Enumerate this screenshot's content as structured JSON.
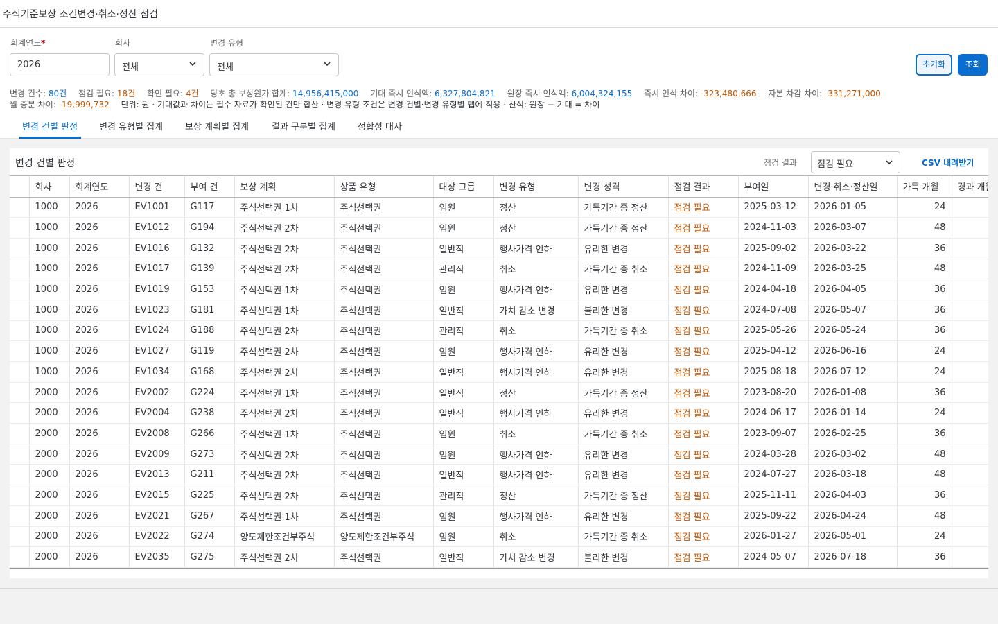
{
  "page": {
    "title": "주식기준보상 조건변경·취소·정산 점검"
  },
  "filters": {
    "fiscal_year": {
      "label": "회계연도",
      "required_mark": "*",
      "value": "2026"
    },
    "company": {
      "label": "회사",
      "value": "전체"
    },
    "change_type": {
      "label": "변경 유형",
      "value": "전체"
    },
    "reset_label": "초기화",
    "search_label": "조회"
  },
  "summary": {
    "items": [
      {
        "label": "변경 건수: ",
        "value": "80건",
        "tone": "v"
      },
      {
        "label": "점검 필요: ",
        "value": "18건",
        "tone": "w"
      },
      {
        "label": "확인 필요: ",
        "value": "4건",
        "tone": "w"
      },
      {
        "label": "당초 총 보상원가 합계: ",
        "value": "14,956,415,000",
        "tone": "v"
      },
      {
        "label": "기대 즉시 인식액: ",
        "value": "6,327,804,821",
        "tone": "v"
      },
      {
        "label": "원장 즉시 인식액: ",
        "value": "6,004,324,155",
        "tone": "v"
      },
      {
        "label": "즉시 인식 차이: ",
        "value": "-323,480,666",
        "tone": "neg"
      },
      {
        "label": "자본 차감 차이: ",
        "value": "-331,271,000",
        "tone": "neg"
      },
      {
        "label": "월 증분 차이: ",
        "value": "-19,999,732",
        "tone": "neg"
      }
    ],
    "note": "단위: 원 · 기대값과 차이는 필수 자료가 확인된 건만 합산 · 변경 유형 조건은 변경 건별·변경 유형별 탭에 적용 · 산식: 원장 − 기대 = 차이"
  },
  "tabs": [
    {
      "label": "변경 건별 판정",
      "active": true
    },
    {
      "label": "변경 유형별 집계",
      "active": false
    },
    {
      "label": "보상 계획별 집계",
      "active": false
    },
    {
      "label": "결과 구분별 집계",
      "active": false
    },
    {
      "label": "정합성 대사",
      "active": false
    }
  ],
  "panel": {
    "title": "변경 건별 판정",
    "result_filter_label": "점검 결과",
    "result_filter_value": "점검 필요",
    "csv_label": "CSV 내려받기"
  },
  "table": {
    "columns": [
      "",
      "회사",
      "회계연도",
      "변경 건",
      "부여 건",
      "보상 계획",
      "상품 유형",
      "대상 그룹",
      "변경 유형",
      "변경 성격",
      "점검 결과",
      "부여일",
      "변경·취소·정산일",
      "가득 개월",
      "경과 개월"
    ],
    "rows": [
      [
        "",
        "1000",
        "2026",
        "EV1001",
        "G117",
        "주식선택권 1차",
        "주식선택권",
        "임원",
        "정산",
        "가득기간 중 정산",
        "점검 필요",
        "2025-03-12",
        "2026-01-05",
        "24",
        ""
      ],
      [
        "",
        "1000",
        "2026",
        "EV1012",
        "G194",
        "주식선택권 2차",
        "주식선택권",
        "임원",
        "정산",
        "가득기간 중 정산",
        "점검 필요",
        "2024-11-03",
        "2026-03-07",
        "48",
        ""
      ],
      [
        "",
        "1000",
        "2026",
        "EV1016",
        "G132",
        "주식선택권 2차",
        "주식선택권",
        "일반직",
        "행사가격 인하",
        "유리한 변경",
        "점검 필요",
        "2025-09-02",
        "2026-03-22",
        "36",
        ""
      ],
      [
        "",
        "1000",
        "2026",
        "EV1017",
        "G139",
        "주식선택권 2차",
        "주식선택권",
        "관리직",
        "취소",
        "가득기간 중 취소",
        "점검 필요",
        "2024-11-09",
        "2026-03-25",
        "48",
        ""
      ],
      [
        "",
        "1000",
        "2026",
        "EV1019",
        "G153",
        "주식선택권 1차",
        "주식선택권",
        "임원",
        "행사가격 인하",
        "유리한 변경",
        "점검 필요",
        "2024-04-18",
        "2026-04-05",
        "36",
        ""
      ],
      [
        "",
        "1000",
        "2026",
        "EV1023",
        "G181",
        "주식선택권 1차",
        "주식선택권",
        "일반직",
        "가치 감소 변경",
        "불리한 변경",
        "점검 필요",
        "2024-07-08",
        "2026-05-07",
        "36",
        ""
      ],
      [
        "",
        "1000",
        "2026",
        "EV1024",
        "G188",
        "주식선택권 2차",
        "주식선택권",
        "관리직",
        "취소",
        "가득기간 중 취소",
        "점검 필요",
        "2025-05-26",
        "2026-05-24",
        "36",
        ""
      ],
      [
        "",
        "1000",
        "2026",
        "EV1027",
        "G119",
        "주식선택권 2차",
        "주식선택권",
        "임원",
        "행사가격 인하",
        "유리한 변경",
        "점검 필요",
        "2025-04-12",
        "2026-06-16",
        "24",
        ""
      ],
      [
        "",
        "1000",
        "2026",
        "EV1034",
        "G168",
        "주식선택권 2차",
        "주식선택권",
        "일반직",
        "행사가격 인하",
        "유리한 변경",
        "점검 필요",
        "2025-08-18",
        "2026-07-12",
        "24",
        ""
      ],
      [
        "",
        "2000",
        "2026",
        "EV2002",
        "G224",
        "주식선택권 1차",
        "주식선택권",
        "일반직",
        "정산",
        "가득기간 중 정산",
        "점검 필요",
        "2023-08-20",
        "2026-01-08",
        "36",
        ""
      ],
      [
        "",
        "2000",
        "2026",
        "EV2004",
        "G238",
        "주식선택권 2차",
        "주식선택권",
        "일반직",
        "행사가격 인하",
        "유리한 변경",
        "점검 필요",
        "2024-06-17",
        "2026-01-14",
        "24",
        ""
      ],
      [
        "",
        "2000",
        "2026",
        "EV2008",
        "G266",
        "주식선택권 1차",
        "주식선택권",
        "임원",
        "취소",
        "가득기간 중 취소",
        "점검 필요",
        "2023-09-07",
        "2026-02-25",
        "36",
        ""
      ],
      [
        "",
        "2000",
        "2026",
        "EV2009",
        "G273",
        "주식선택권 2차",
        "주식선택권",
        "임원",
        "행사가격 인하",
        "유리한 변경",
        "점검 필요",
        "2024-03-28",
        "2026-03-02",
        "48",
        ""
      ],
      [
        "",
        "2000",
        "2026",
        "EV2013",
        "G211",
        "주식선택권 2차",
        "주식선택권",
        "일반직",
        "행사가격 인하",
        "유리한 변경",
        "점검 필요",
        "2024-07-27",
        "2026-03-18",
        "48",
        ""
      ],
      [
        "",
        "2000",
        "2026",
        "EV2015",
        "G225",
        "주식선택권 2차",
        "주식선택권",
        "관리직",
        "정산",
        "가득기간 중 정산",
        "점검 필요",
        "2025-11-11",
        "2026-04-03",
        "36",
        ""
      ],
      [
        "",
        "2000",
        "2026",
        "EV2021",
        "G267",
        "주식선택권 1차",
        "주식선택권",
        "임원",
        "행사가격 인하",
        "유리한 변경",
        "점검 필요",
        "2025-09-22",
        "2026-04-24",
        "48",
        ""
      ],
      [
        "",
        "2000",
        "2026",
        "EV2022",
        "G274",
        "양도제한조건부주식",
        "양도제한조건부주식",
        "임원",
        "취소",
        "가득기간 중 취소",
        "점검 필요",
        "2026-01-27",
        "2026-05-01",
        "24",
        ""
      ],
      [
        "",
        "2000",
        "2026",
        "EV2035",
        "G275",
        "주식선택권 2차",
        "주식선택권",
        "일반직",
        "가치 감소 변경",
        "불리한 변경",
        "점검 필요",
        "2024-05-07",
        "2026-07-18",
        "36",
        ""
      ]
    ]
  },
  "colors": {
    "accent": "#0a6ed1",
    "warning": "#c35500",
    "background": "#f2f2f2"
  },
  "icons": {
    "dropdown": "chevron-down-icon"
  }
}
